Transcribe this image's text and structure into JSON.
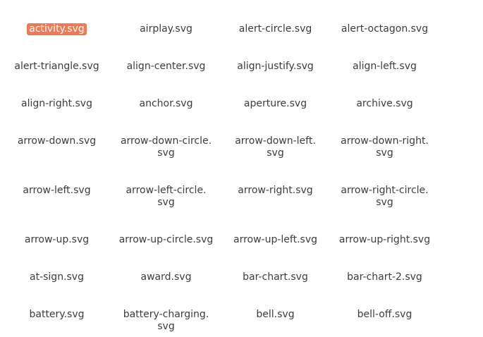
{
  "selected_index": 0,
  "files": [
    [
      "activity.svg"
    ],
    [
      "airplay.svg"
    ],
    [
      "alert-circle.svg"
    ],
    [
      "alert-octagon.svg"
    ],
    [
      "alert-triangle.svg"
    ],
    [
      "align-center.svg"
    ],
    [
      "align-justify.svg"
    ],
    [
      "align-left.svg"
    ],
    [
      "align-right.svg"
    ],
    [
      "anchor.svg"
    ],
    [
      "aperture.svg"
    ],
    [
      "archive.svg"
    ],
    [
      "arrow-down.svg"
    ],
    [
      "arrow-down-circle.",
      "svg"
    ],
    [
      "arrow-down-left.",
      "svg"
    ],
    [
      "arrow-down-right.",
      "svg"
    ],
    [
      "arrow-left.svg"
    ],
    [
      "arrow-left-circle.",
      "svg"
    ],
    [
      "arrow-right.svg"
    ],
    [
      "arrow-right-circle.",
      "svg"
    ],
    [
      "arrow-up.svg"
    ],
    [
      "arrow-up-circle.svg"
    ],
    [
      "arrow-up-left.svg"
    ],
    [
      "arrow-up-right.svg"
    ],
    [
      "at-sign.svg"
    ],
    [
      "award.svg"
    ],
    [
      "bar-chart.svg"
    ],
    [
      "bar-chart-2.svg"
    ],
    [
      "battery.svg"
    ],
    [
      "battery-charging.",
      "svg"
    ],
    [
      "bell.svg"
    ],
    [
      "bell-off.svg"
    ]
  ]
}
